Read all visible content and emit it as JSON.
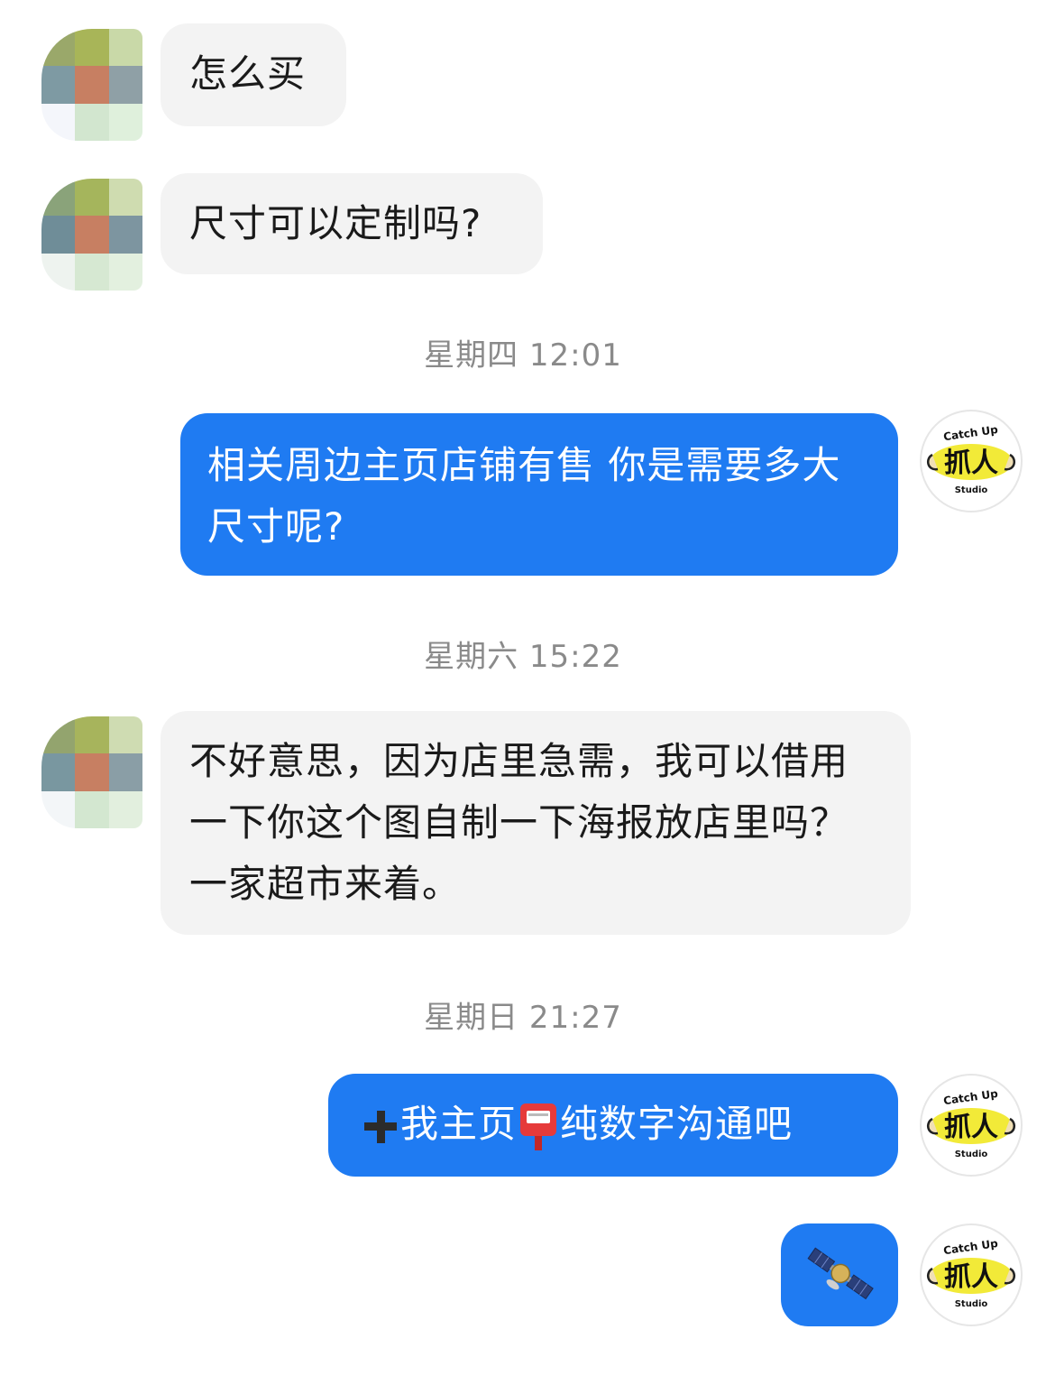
{
  "messages": [
    {
      "text": "怎么买"
    },
    {
      "text": "尺寸可以定制吗?"
    },
    {
      "timestamp": "星期四 12:01"
    },
    {
      "text": "相关周边主页店铺有售 你是需要多大尺寸呢?"
    },
    {
      "timestamp": "星期六 15:22"
    },
    {
      "text": "不好意思，因为店里急需，我可以借用一下你这个图自制一下海报放店里吗？一家超市来着。"
    },
    {
      "timestamp": "星期日 21:27"
    },
    {
      "text": "我主页",
      "text2": "纯数字沟通吧",
      "icon1": "plus-icon",
      "icon2": "postbox-icon"
    },
    {
      "icon": "satellite-icon"
    }
  ],
  "logo": {
    "top_text": "Catch Up",
    "middle_text": "抓人",
    "bottom_text": "Studio"
  },
  "colors": {
    "outgoing_bubble": "#1f7bf2",
    "incoming_bubble": "#f3f3f3",
    "timestamp_text": "#8a8a8a"
  }
}
